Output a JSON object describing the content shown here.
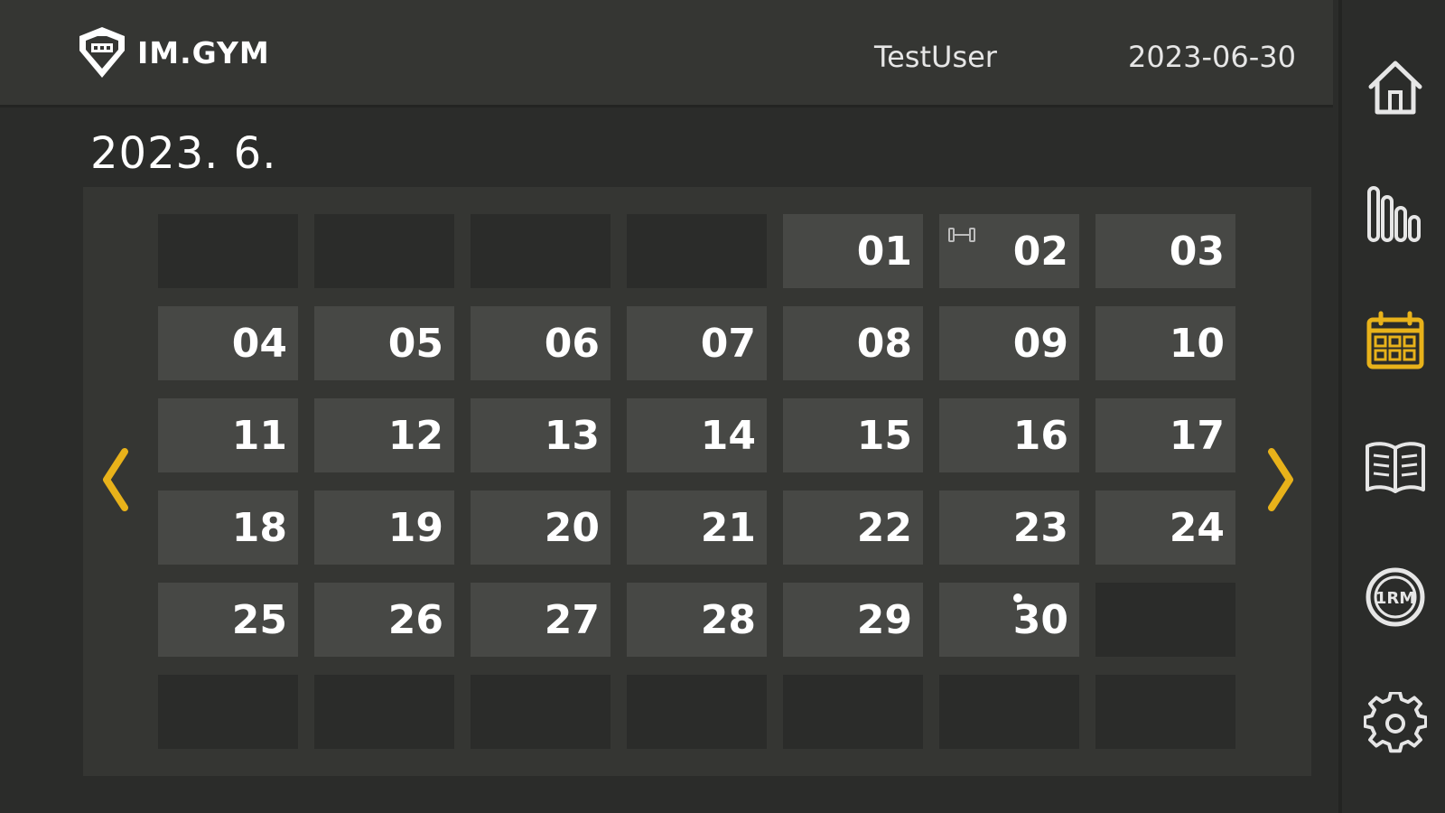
{
  "header": {
    "brand": "IM.GYM",
    "user": "TestUser",
    "date": "2023-06-30"
  },
  "calendar": {
    "month_title": "2023.  6.",
    "weeks": [
      [
        "",
        "",
        "",
        "",
        "01",
        "02",
        "03"
      ],
      [
        "04",
        "05",
        "06",
        "07",
        "08",
        "09",
        "10"
      ],
      [
        "11",
        "12",
        "13",
        "14",
        "15",
        "16",
        "17"
      ],
      [
        "18",
        "19",
        "20",
        "21",
        "22",
        "23",
        "24"
      ],
      [
        "25",
        "26",
        "27",
        "28",
        "29",
        "30",
        ""
      ],
      [
        "",
        "",
        "",
        "",
        "",
        "",
        ""
      ]
    ],
    "workout_days": [
      "02"
    ],
    "today": "30"
  },
  "sidebar": {
    "items": [
      {
        "name": "home-icon",
        "active": false
      },
      {
        "name": "stats-icon",
        "active": false
      },
      {
        "name": "calendar-icon",
        "active": true
      },
      {
        "name": "book-icon",
        "active": false
      },
      {
        "name": "one-rm-icon",
        "label": "1RM",
        "active": false
      },
      {
        "name": "gear-icon",
        "active": false
      }
    ]
  },
  "colors": {
    "accent": "#e8b21a",
    "icon": "#e6e6e6",
    "background": "#2b2c2a",
    "panel": "#353633",
    "cell": "#474845"
  }
}
